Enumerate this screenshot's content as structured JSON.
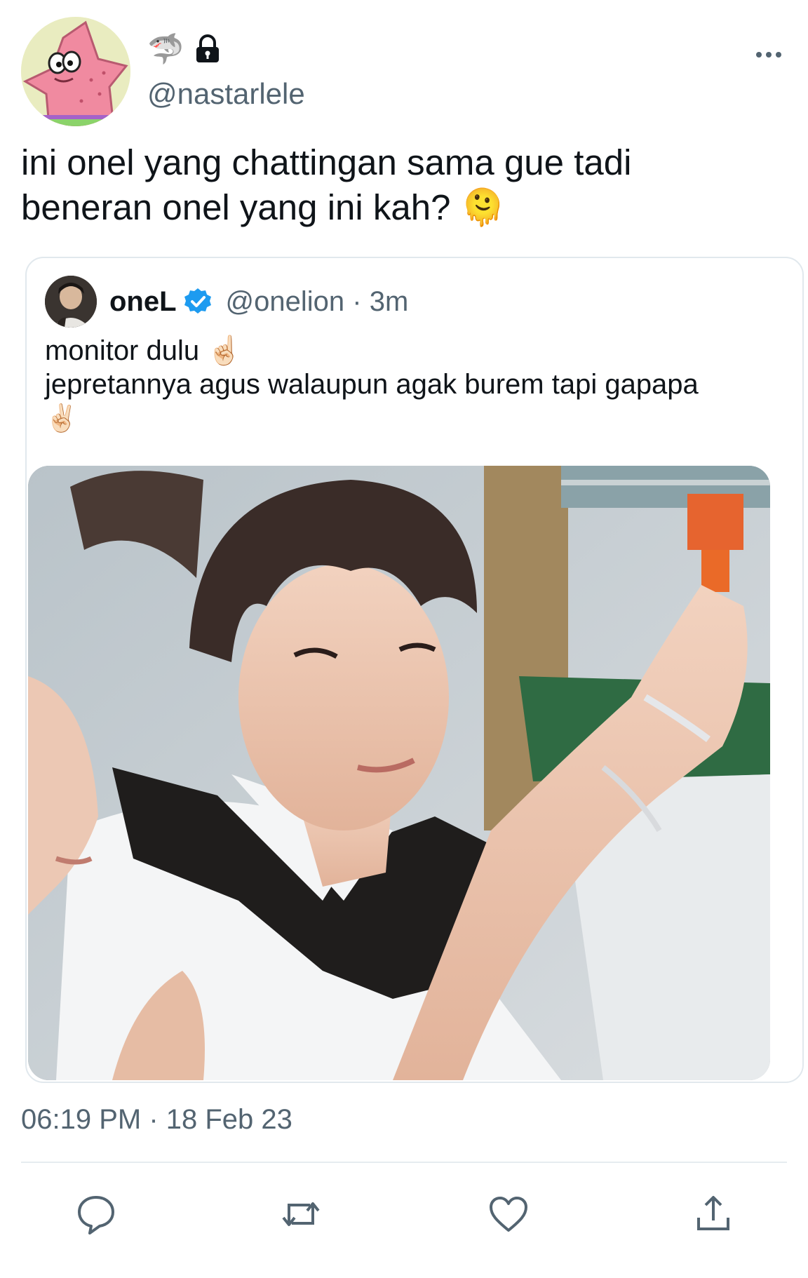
{
  "user": {
    "handle": "@nastarlele",
    "name_emoji": "🦈",
    "avatar_icon": "patrick-star-avatar",
    "locked": true
  },
  "tweet": {
    "text_lines": [
      "ini onel yang chattingan sama gue tadi",
      "beneran onel yang ini kah? 🫠"
    ],
    "timestamp": "06:19 PM · 18 Feb 23"
  },
  "quoted_tweet": {
    "name": "oneL",
    "verified": true,
    "handle_time": "@onelion · 3m",
    "text_lines": [
      "monitor dulu ☝🏻",
      "jepretannya agus walaupun agak burem tapi gapapa",
      "✌🏻"
    ],
    "media_icon": "photo-boy-white-collar"
  },
  "actions": {
    "reply_icon": "reply-icon",
    "retweet_icon": "retweet-icon",
    "like_icon": "heart-icon",
    "share_icon": "share-icon"
  },
  "colors": {
    "secondary_text": "#536471",
    "verified_blue": "#1d9bf0",
    "border": "#e1e8ed"
  }
}
